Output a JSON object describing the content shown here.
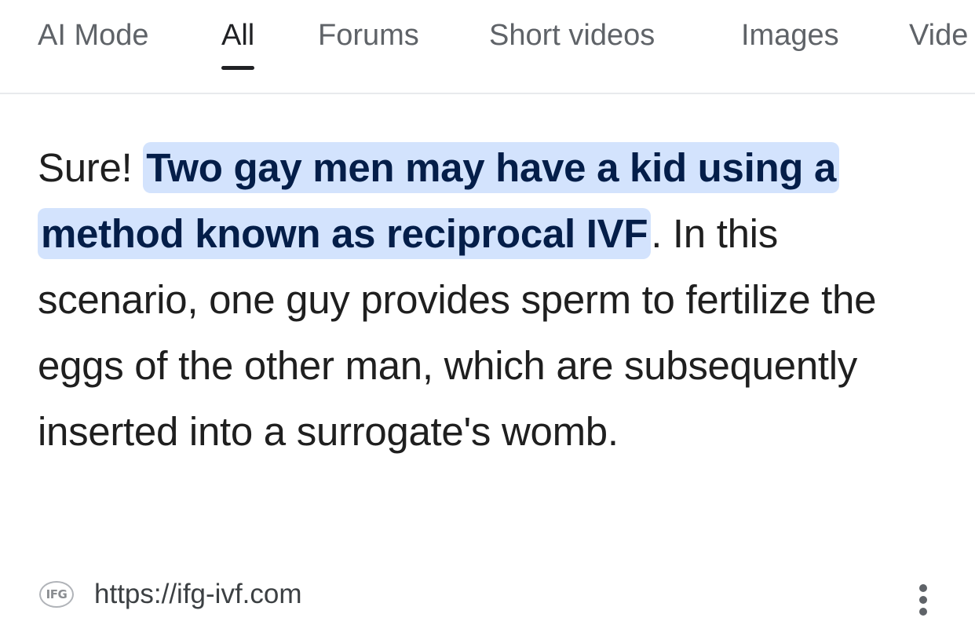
{
  "tabs": {
    "items": [
      {
        "label": "AI Mode"
      },
      {
        "label": "All"
      },
      {
        "label": "Forums"
      },
      {
        "label": "Short videos"
      },
      {
        "label": "Images"
      },
      {
        "label": "Vide"
      }
    ],
    "active_index": 1
  },
  "snippet": {
    "lead": "Sure! ",
    "highlight": "Two gay men may have a kid using a method known as reciprocal IVF",
    "rest": ". In this scenario, one guy provides sperm to fertilize the eggs of the other man, which are subsequently inserted into a surrogate's womb."
  },
  "source": {
    "favicon_text": "IFG",
    "url": "https://ifg-ivf.com",
    "more_icon": "three-dots-vertical-icon"
  },
  "colors": {
    "highlight_background": "#d3e3fd",
    "highlight_text": "#041e49",
    "active_tab": "#202124",
    "inactive_tab": "#5f6368"
  }
}
